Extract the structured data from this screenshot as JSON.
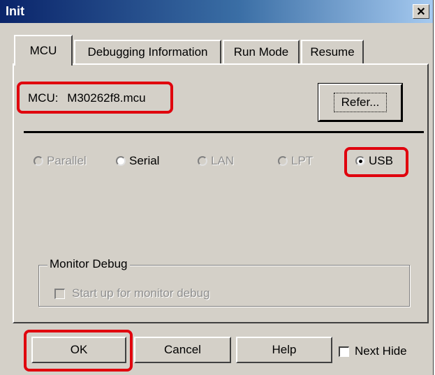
{
  "window": {
    "title": "Init",
    "close_glyph": "✕"
  },
  "tabs": [
    {
      "label": "MCU",
      "active": true
    },
    {
      "label": "Debugging Information",
      "active": false
    },
    {
      "label": "Run Mode",
      "active": false
    },
    {
      "label": "Resume",
      "active": false
    }
  ],
  "mcu": {
    "label": "MCU:",
    "value": "M30262f8.mcu",
    "refer_label": "Refer..."
  },
  "connection": {
    "options": [
      {
        "label": "Parallel",
        "enabled": false,
        "checked": false
      },
      {
        "label": "Serial",
        "enabled": true,
        "checked": false
      },
      {
        "label": "LAN",
        "enabled": false,
        "checked": false
      },
      {
        "label": "LPT",
        "enabled": false,
        "checked": false
      },
      {
        "label": "USB",
        "enabled": true,
        "checked": true
      }
    ]
  },
  "monitor_debug": {
    "group_label": "Monitor Debug",
    "checkbox_label": "Start up for monitor debug",
    "checked": false,
    "enabled": false
  },
  "buttons": {
    "ok": "OK",
    "cancel": "Cancel",
    "help": "Help"
  },
  "next_hide": {
    "label": "Next Hide",
    "checked": false
  },
  "highlight_color": "#e0000d"
}
